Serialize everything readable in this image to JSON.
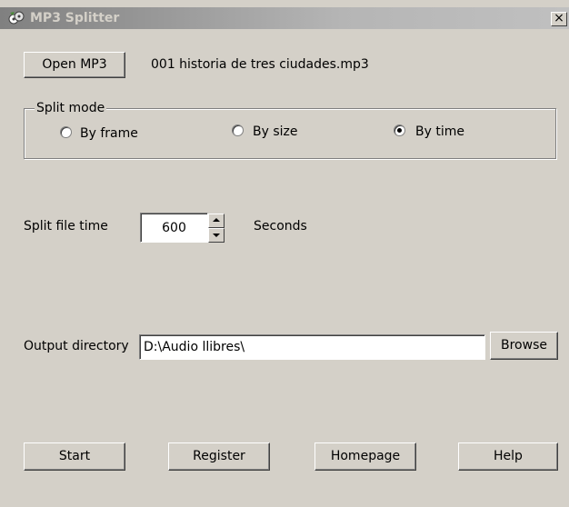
{
  "window": {
    "title": "MP3 Splitter",
    "close_glyph": "×"
  },
  "file": {
    "open_button": "Open MP3",
    "filename": "001 historia de tres ciudades.mp3"
  },
  "split_mode": {
    "legend": "Split mode",
    "options": [
      {
        "label": "By frame",
        "selected": false
      },
      {
        "label": "By size",
        "selected": false
      },
      {
        "label": "By time",
        "selected": true
      }
    ]
  },
  "split_time": {
    "label": "Split file time",
    "value": "600",
    "unit": "Seconds"
  },
  "output": {
    "label": "Output directory",
    "path": "D:\\Audio llibres\\",
    "browse_button": "Browse"
  },
  "actions": {
    "start": "Start",
    "register": "Register",
    "homepage": "Homepage",
    "help": "Help"
  },
  "icons": {
    "app": "mp3-splitter-app-icon",
    "close": "close-icon",
    "spin_up": "arrow-up-icon",
    "spin_down": "arrow-down-icon"
  }
}
